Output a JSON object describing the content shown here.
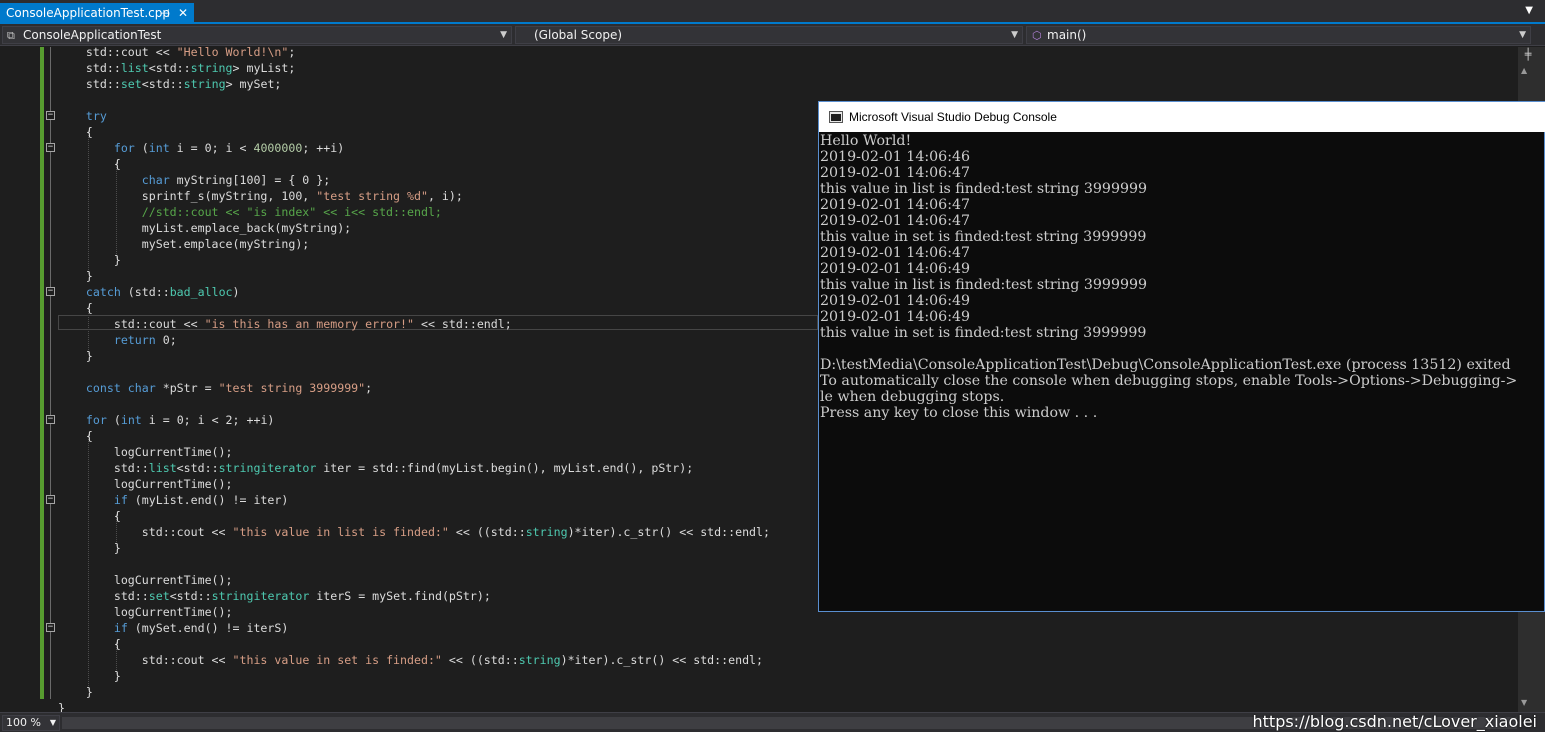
{
  "tab": {
    "title": "ConsoleApplicationTest.cpp",
    "pin_glyph": "⊣",
    "close_glyph": "✕"
  },
  "navbar": {
    "project": "ConsoleApplicationTest",
    "scope": "(Global Scope)",
    "function": "main()"
  },
  "code_lines": [
    [
      [
        "",
        "    std::cout << "
      ],
      [
        "st",
        "\"Hello World!\\n\""
      ],
      [
        "",
        ";"
      ]
    ],
    [
      [
        "",
        "    std::"
      ],
      [
        "ty",
        "list"
      ],
      [
        "",
        "<std::"
      ],
      [
        "ty",
        "string"
      ],
      [
        "",
        "> myList;"
      ]
    ],
    [
      [
        "",
        "    std::"
      ],
      [
        "ty",
        "set"
      ],
      [
        "",
        "<std::"
      ],
      [
        "ty",
        "string"
      ],
      [
        "",
        "> mySet;"
      ]
    ],
    [],
    [
      [
        "kw",
        "    try"
      ]
    ],
    [
      [
        "",
        "    {"
      ]
    ],
    [
      [
        "kw",
        "        for"
      ],
      [
        "",
        " ("
      ],
      [
        "kw",
        "int"
      ],
      [
        "",
        " i = 0; i < "
      ],
      [
        "nu",
        "4000000"
      ],
      [
        "",
        "; ++i)"
      ]
    ],
    [
      [
        "",
        "        {"
      ]
    ],
    [
      [
        "kw",
        "            char"
      ],
      [
        "",
        " myString[100] = { 0 };"
      ]
    ],
    [
      [
        "",
        "            sprintf_s(myString, 100, "
      ],
      [
        "st",
        "\"test string %d\""
      ],
      [
        "",
        ", i);"
      ]
    ],
    [
      [
        "cm",
        "            //std::cout << \"is index\" << i<< std::endl;"
      ]
    ],
    [
      [
        "",
        "            myList.emplace_back(myString);"
      ]
    ],
    [
      [
        "",
        "            mySet.emplace(myString);"
      ]
    ],
    [
      [
        "",
        "        }"
      ]
    ],
    [
      [
        "",
        "    }"
      ]
    ],
    [
      [
        "kw",
        "    catch"
      ],
      [
        "",
        " (std::"
      ],
      [
        "ty",
        "bad_alloc"
      ],
      [
        "",
        ")"
      ]
    ],
    [
      [
        "",
        "    {"
      ]
    ],
    [
      [
        "",
        "        std::cout << "
      ],
      [
        "st",
        "\"is this has an memory error!\""
      ],
      [
        "",
        " << std::endl;"
      ]
    ],
    [
      [
        "kw",
        "        return"
      ],
      [
        "",
        " 0;"
      ]
    ],
    [
      [
        "",
        "    }"
      ]
    ],
    [],
    [
      [
        "kw",
        "    const char"
      ],
      [
        "",
        " *pStr = "
      ],
      [
        "st",
        "\"test string 3999999\""
      ],
      [
        "",
        ";"
      ]
    ],
    [],
    [
      [
        "kw",
        "    for"
      ],
      [
        "",
        " ("
      ],
      [
        "kw",
        "int"
      ],
      [
        "",
        " i = 0; i < 2; ++i)"
      ]
    ],
    [
      [
        "",
        "    {"
      ]
    ],
    [
      [
        "",
        "        logCurrentTime();"
      ]
    ],
    [
      [
        "",
        "        std::"
      ],
      [
        "ty",
        "list"
      ],
      [
        "",
        "<std::"
      ],
      [
        "ty",
        "string"
      ],
      [
        ">::"
      ],
      [
        "ty",
        "iterator"
      ],
      [
        "",
        " iter = std::find(myList.begin(), myList.end(), pStr);"
      ]
    ],
    [
      [
        "",
        "        logCurrentTime();"
      ]
    ],
    [
      [
        "kw",
        "        if"
      ],
      [
        "",
        " (myList.end() != iter)"
      ]
    ],
    [
      [
        "",
        "        {"
      ]
    ],
    [
      [
        "",
        "            std::cout << "
      ],
      [
        "st",
        "\"this value in list is finded:\""
      ],
      [
        "",
        " << ((std::"
      ],
      [
        "ty",
        "string"
      ],
      [
        "",
        ")*iter).c_str() << std::endl;"
      ]
    ],
    [
      [
        "",
        "        }"
      ]
    ],
    [],
    [
      [
        "",
        "        logCurrentTime();"
      ]
    ],
    [
      [
        "",
        "        std::"
      ],
      [
        "ty",
        "set"
      ],
      [
        "",
        "<std::"
      ],
      [
        "ty",
        "string"
      ],
      [
        ">::"
      ],
      [
        "ty",
        "iterator"
      ],
      [
        "",
        " iterS = mySet.find(pStr);"
      ]
    ],
    [
      [
        "",
        "        logCurrentTime();"
      ]
    ],
    [
      [
        "kw",
        "        if"
      ],
      [
        "",
        " (mySet.end() != iterS)"
      ]
    ],
    [
      [
        "",
        "        {"
      ]
    ],
    [
      [
        "",
        "            std::cout << "
      ],
      [
        "st",
        "\"this value in set is finded:\""
      ],
      [
        "",
        " << ((std::"
      ],
      [
        "ty",
        "string"
      ],
      [
        "",
        ")*iter).c_str() << std::endl;"
      ]
    ],
    [
      [
        "",
        "        }"
      ]
    ],
    [
      [
        "",
        "    }"
      ]
    ],
    [
      [
        "",
        "}"
      ]
    ]
  ],
  "console": {
    "title": "Microsoft Visual Studio Debug Console",
    "lines": [
      "Hello World!",
      "2019-02-01 14:06:46",
      "2019-02-01 14:06:47",
      "this value in list is finded:test string 3999999",
      "2019-02-01 14:06:47",
      "2019-02-01 14:06:47",
      "this value in set is finded:test string 3999999",
      "2019-02-01 14:06:47",
      "2019-02-01 14:06:49",
      "this value in list is finded:test string 3999999",
      "2019-02-01 14:06:49",
      "2019-02-01 14:06:49",
      "this value in set is finded:test string 3999999",
      "",
      "D:\\testMedia\\ConsoleApplicationTest\\Debug\\ConsoleApplicationTest.exe (process 13512) exited",
      "To automatically close the console when debugging stops, enable Tools->Options->Debugging->",
      "le when debugging stops.",
      "Press any key to close this window . . ."
    ]
  },
  "status": {
    "zoom": "100 %"
  },
  "watermark": "https://blog.csdn.net/cLover_xiaolei",
  "colors": {
    "accent": "#007acc",
    "keyword": "#569cd6",
    "type": "#4ec9b0",
    "string": "#d69d85",
    "comment": "#57a64a",
    "number": "#b5cea8",
    "change_bar": "#579c2f"
  }
}
